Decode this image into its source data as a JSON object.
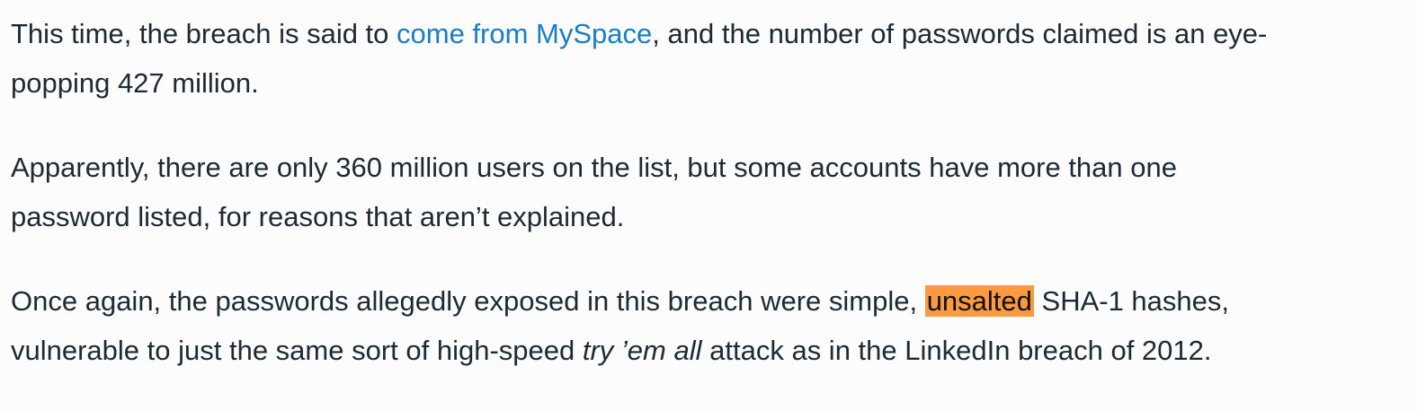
{
  "paragraphs": [
    {
      "l1a": "This time, the breach is said to ",
      "link": "come from MySpace",
      "l1b": ", and the number of passwords claimed is an eye-",
      "l2": "popping 427 million."
    },
    {
      "l1": "Apparently, there are only 360 million users on the list, but some accounts have more than one",
      "l2": "password listed, for reasons that aren’t explained."
    },
    {
      "l1a": "Once again, the passwords allegedly exposed in this breach were simple, ",
      "highlight": "unsalted",
      "l1b": " SHA-1 hashes,",
      "l2a": "vulnerable to just the same sort of high-speed ",
      "em": "try ’em all",
      "l2b": " attack as in the LinkedIn breach of 2012."
    }
  ],
  "colors": {
    "link": "#1a7ec4",
    "highlight": "#fd9940",
    "text": "#1d2a33"
  }
}
